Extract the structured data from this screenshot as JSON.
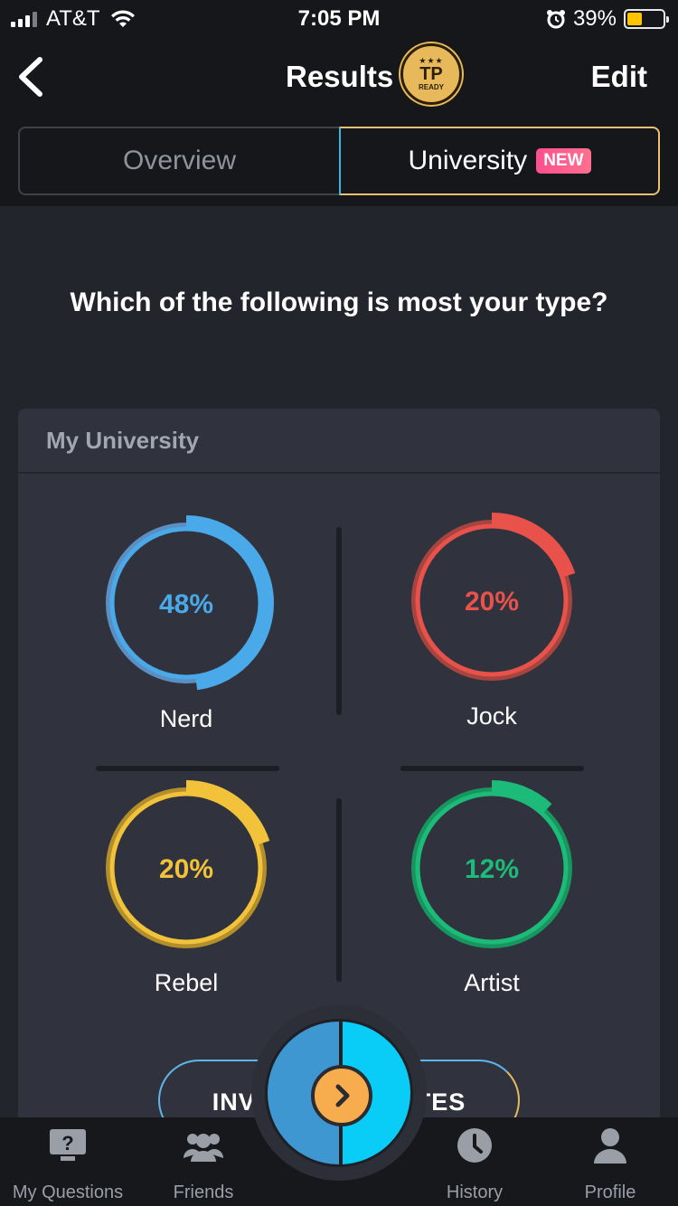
{
  "status_bar": {
    "carrier": "AT&T",
    "time": "7:05 PM",
    "battery_percent": "39%",
    "battery_level": 0.39
  },
  "nav": {
    "title": "Results",
    "badge": {
      "stars": "★★★",
      "main": "TP",
      "sub": "READY"
    },
    "edit_label": "Edit"
  },
  "tabs": {
    "overview": "Overview",
    "university": "University",
    "new_badge": "NEW"
  },
  "question": "Which of the following is most your type?",
  "card": {
    "title": "My University",
    "results": [
      {
        "label": "Nerd",
        "percent_text": "48%",
        "value": 48,
        "color": "#4aa9e9",
        "track": "#5a8fc4"
      },
      {
        "label": "Jock",
        "percent_text": "20%",
        "value": 20,
        "color": "#e8524a",
        "track": "#a8443f"
      },
      {
        "label": "Rebel",
        "percent_text": "20%",
        "value": 20,
        "color": "#f2c23a",
        "track": "#b38f2c"
      },
      {
        "label": "Artist",
        "percent_text": "12%",
        "value": 12,
        "color": "#1dbb7a",
        "track": "#18965f"
      }
    ]
  },
  "invite_button": {
    "label_left": "INVI",
    "label_right": "ATES"
  },
  "tabbar": {
    "items": [
      {
        "label": "My Questions",
        "icon": "question-icon"
      },
      {
        "label": "Friends",
        "icon": "friends-icon"
      },
      {
        "label": "History",
        "icon": "clock-icon"
      },
      {
        "label": "Profile",
        "icon": "profile-icon"
      }
    ]
  },
  "colors": {
    "background": "#23252c",
    "header": "#16171b",
    "card": "#30333d",
    "accent_blue": "#09cdf7",
    "accent_orange": "#f7ad4d"
  }
}
